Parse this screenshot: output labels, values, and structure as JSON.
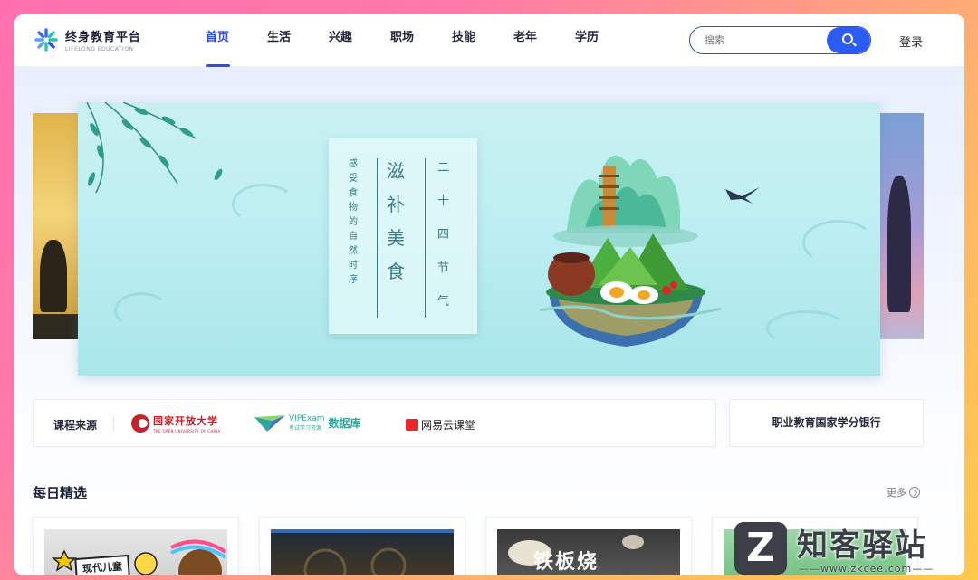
{
  "brand": {
    "title": "终身教育平台",
    "subtitle": "LIFELONG EDUCATION",
    "accent": "#2b4cf0"
  },
  "nav": {
    "items": [
      {
        "label": "首页",
        "active": true
      },
      {
        "label": "生活"
      },
      {
        "label": "兴趣"
      },
      {
        "label": "职场"
      },
      {
        "label": "技能"
      },
      {
        "label": "老年"
      },
      {
        "label": "学历"
      }
    ]
  },
  "search": {
    "placeholder": "搜索",
    "icon": "search-icon"
  },
  "login_label": "登录",
  "banner": {
    "col_right": [
      "二",
      "十",
      "四",
      "节",
      "气"
    ],
    "col_mid": [
      "滋",
      "补",
      "美",
      "食"
    ],
    "col_left": [
      "感",
      "受",
      "食",
      "物",
      "的",
      "自",
      "然",
      "时",
      "序"
    ]
  },
  "sources": {
    "label": "课程来源",
    "ouc": {
      "cn": "国家开放大学",
      "en": "THE OPEN UNIVERSITY OF CHINA"
    },
    "vip": {
      "en": "VIPExam",
      "cn": "考试学习资源",
      "db": "数据库"
    },
    "netease": {
      "label": "网易云课堂"
    }
  },
  "bank_label": "职业教育国家学分银行",
  "daily": {
    "title": "每日精选",
    "more": "更多",
    "cards": [
      {
        "thumb_text": "现代儿童"
      },
      {
        "thumb_text": ""
      },
      {
        "thumb_text": "铁板烧"
      },
      {
        "thumb_text": ""
      }
    ]
  },
  "watermark": {
    "letter": "Z",
    "cn": "知客驿站",
    "url": "——www.zkcee.com——"
  }
}
